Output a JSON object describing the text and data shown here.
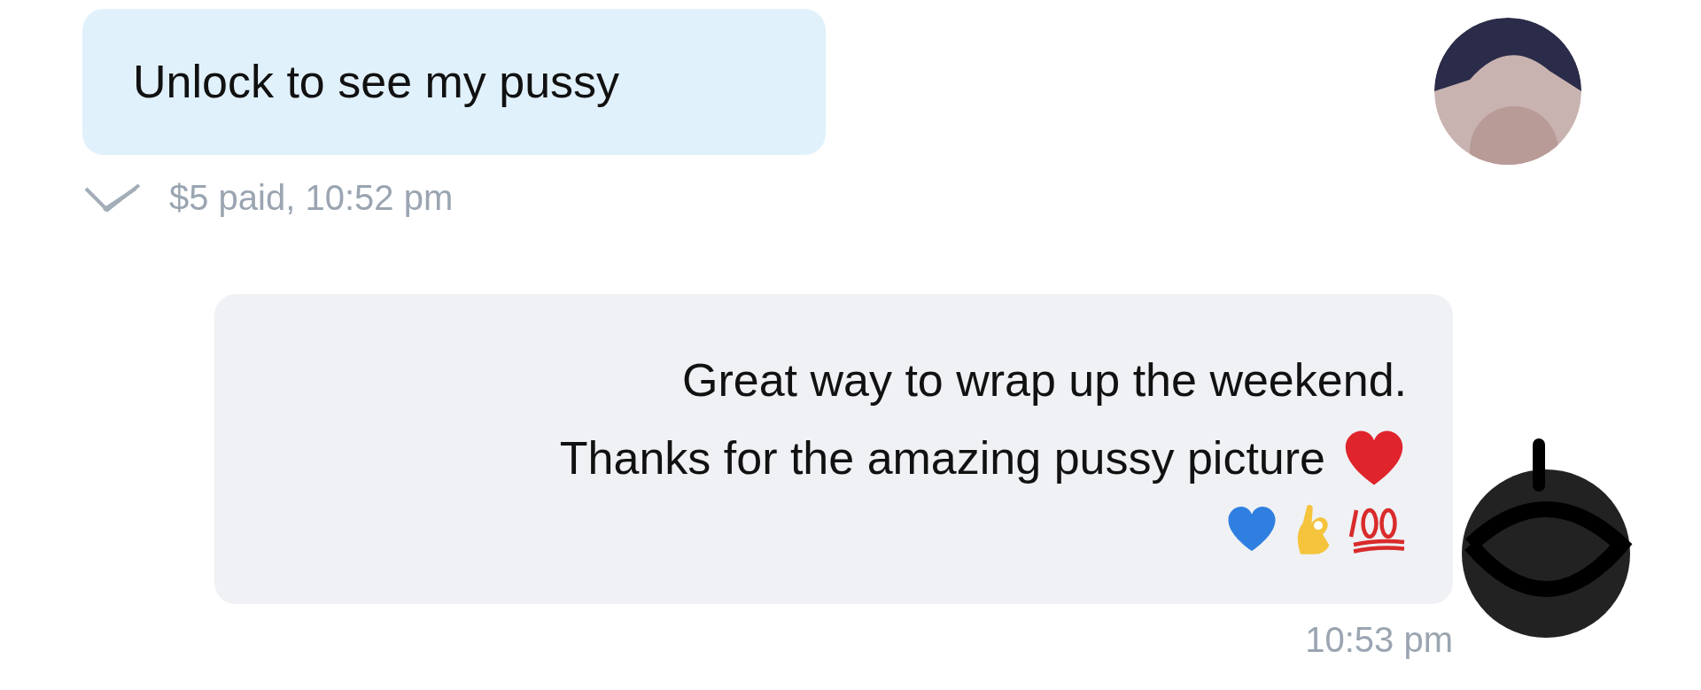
{
  "messages": [
    {
      "kind": "incoming",
      "lines": [
        "Unlock to see my pussy"
      ],
      "meta": "$5 paid, 10:52 pm",
      "read": true
    },
    {
      "kind": "outgoing",
      "lines": [
        "Great way to wrap up the weekend.",
        "Thanks for the amazing pussy picture"
      ],
      "meta": "10:53 pm",
      "read": false
    }
  ]
}
